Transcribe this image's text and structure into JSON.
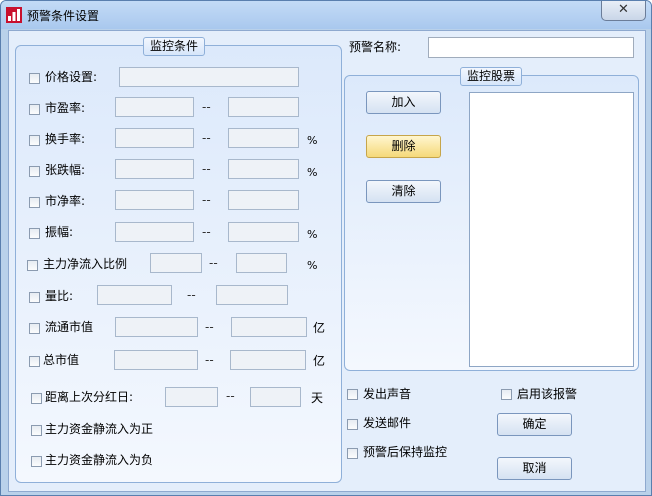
{
  "window": {
    "title": "预警条件设置",
    "close_glyph": "✕"
  },
  "monitor_conditions": {
    "group_title": "监控条件",
    "range_sep": "--",
    "rows": [
      {
        "label": "价格设置:"
      },
      {
        "label": "市盈率:"
      },
      {
        "label": "换手率:",
        "unit": "%"
      },
      {
        "label": "张跌幅:",
        "unit": "%"
      },
      {
        "label": "市净率:"
      },
      {
        "label": "振幅:",
        "unit": "%"
      },
      {
        "label": "主力净流入比例",
        "unit": "%"
      },
      {
        "label": "量比:"
      },
      {
        "label": "流通市值",
        "unit": "亿"
      },
      {
        "label": "总市值",
        "unit": "亿"
      },
      {
        "label": "距离上次分红日:",
        "unit": "天"
      },
      {
        "label": "主力资金静流入为正"
      },
      {
        "label": "主力资金静流入为负"
      }
    ]
  },
  "alert_name": {
    "label": "预警名称:",
    "value": ""
  },
  "monitor_stocks": {
    "group_title": "监控股票",
    "add_label": "加入",
    "delete_label": "删除",
    "clear_label": "清除"
  },
  "options": {
    "sound_label": "发出声音",
    "email_label": "发送邮件",
    "keep_label": "预警后保持监控",
    "enable_label": "启用该报警"
  },
  "actions": {
    "ok_label": "确定",
    "cancel_label": "取消"
  },
  "colors": {
    "hot_button": "#f5d97a",
    "panel": "#dce9fb",
    "frame": "#b9d1ea"
  }
}
